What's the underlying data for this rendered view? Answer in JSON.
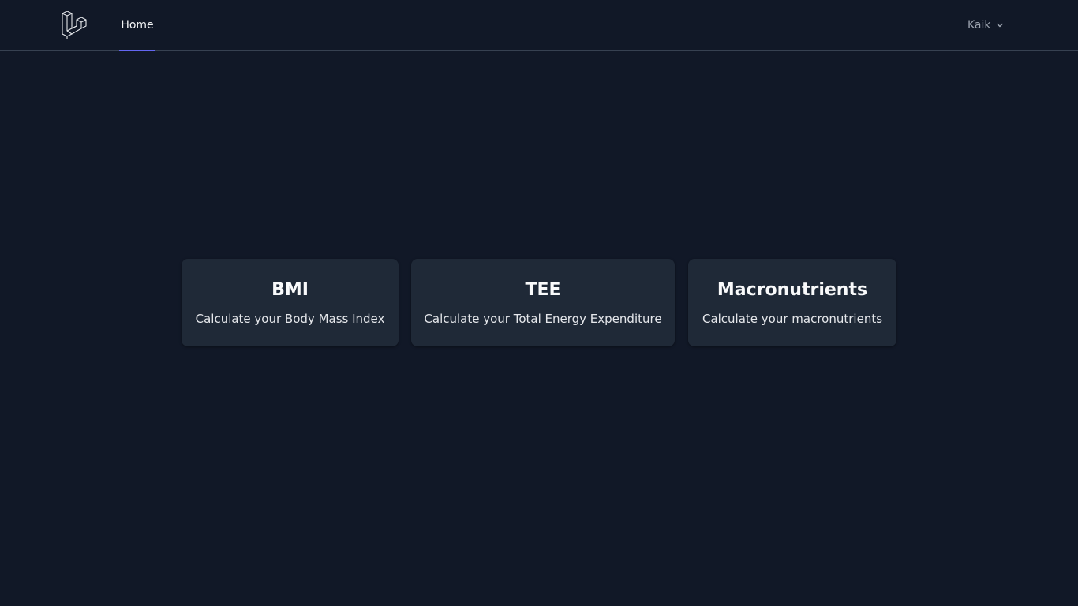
{
  "nav": {
    "home_label": "Home",
    "user_name": "Kaik"
  },
  "cards": [
    {
      "title": "BMI",
      "description": "Calculate your Body Mass Index"
    },
    {
      "title": "TEE",
      "description": "Calculate your Total Energy Expenditure"
    },
    {
      "title": "Macronutrients",
      "description": "Calculate your macronutrients"
    }
  ],
  "colors": {
    "background": "#111827",
    "card": "#1f2937",
    "accent": "#6366f1",
    "border": "#374151"
  }
}
